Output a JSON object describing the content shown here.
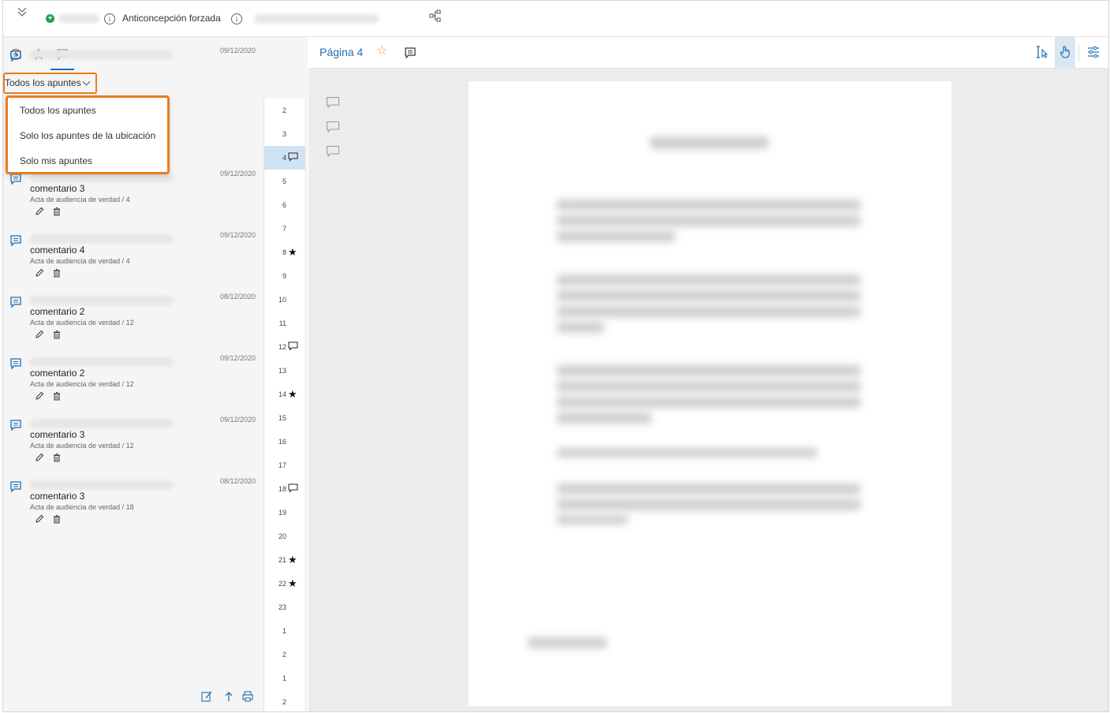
{
  "topbar": {
    "case_title": "Anticoncepción forzada",
    "info_symbol": "i"
  },
  "left_panel": {
    "tabs": [
      "history-icon",
      "favorites-icon",
      "notes-icon"
    ],
    "filter": {
      "selected": "Todos los apuntes",
      "options": [
        "Todos los apuntes",
        "Solo los apuntes de la ubicación",
        "Solo mis apuntes"
      ]
    },
    "notes": [
      {
        "date": "09/12/2020",
        "title": "",
        "subtitle": ""
      },
      {
        "date": "09/12/2020",
        "title": "comentario 3",
        "subtitle": "Acta de audiencia de verdad / 4"
      },
      {
        "date": "09/12/2020",
        "title": "comentario 4",
        "subtitle": "Acta de audiencia de verdad / 4"
      },
      {
        "date": "08/12/2020",
        "title": "comentario 2",
        "subtitle": "Acta de audiencia de verdad / 12"
      },
      {
        "date": "09/12/2020",
        "title": "comentario 2",
        "subtitle": "Acta de audiencia de verdad / 12"
      },
      {
        "date": "09/12/2020",
        "title": "comentario 3",
        "subtitle": "Acta de audiencia de verdad / 12"
      },
      {
        "date": "08/12/2020",
        "title": "comentario 3",
        "subtitle": "Acta de audiencia de verdad / 18"
      }
    ],
    "pages": [
      {
        "n": "2",
        "mark": ""
      },
      {
        "n": "3",
        "mark": ""
      },
      {
        "n": "4",
        "mark": "comment",
        "active": true
      },
      {
        "n": "5",
        "mark": ""
      },
      {
        "n": "6",
        "mark": ""
      },
      {
        "n": "7",
        "mark": ""
      },
      {
        "n": "8",
        "mark": "star"
      },
      {
        "n": "9",
        "mark": ""
      },
      {
        "n": "10",
        "mark": ""
      },
      {
        "n": "11",
        "mark": ""
      },
      {
        "n": "12",
        "mark": "comment"
      },
      {
        "n": "13",
        "mark": ""
      },
      {
        "n": "14",
        "mark": "star"
      },
      {
        "n": "15",
        "mark": ""
      },
      {
        "n": "16",
        "mark": ""
      },
      {
        "n": "17",
        "mark": ""
      },
      {
        "n": "18",
        "mark": "comment"
      },
      {
        "n": "19",
        "mark": ""
      },
      {
        "n": "20",
        "mark": ""
      },
      {
        "n": "21",
        "mark": "star"
      },
      {
        "n": "22",
        "mark": "star"
      },
      {
        "n": "23",
        "mark": ""
      },
      {
        "n": "1",
        "mark": ""
      },
      {
        "n": "2",
        "mark": ""
      },
      {
        "n": "1",
        "mark": ""
      },
      {
        "n": "2",
        "mark": ""
      }
    ],
    "bottom_tools": [
      "new-note-icon",
      "export-icon",
      "print-icon"
    ]
  },
  "viewer": {
    "page_label": "Página 4",
    "star_symbol": "☆",
    "tools": [
      "text-select-icon",
      "hand-pan-icon",
      "settings-sliders-icon"
    ]
  },
  "colors": {
    "accent": "#1f6fb5",
    "highlight_orange": "#e87d1e",
    "active_page": "#cfe3f3",
    "add_green": "#1fa34a",
    "star_favorite": "#f0a020"
  }
}
